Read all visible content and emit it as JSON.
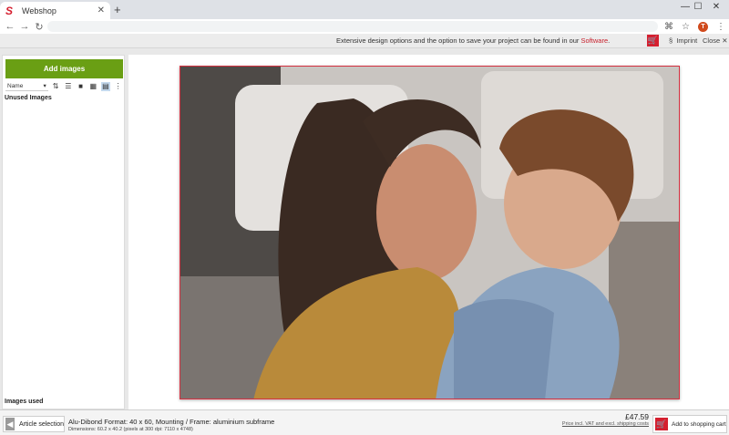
{
  "browser": {
    "tab_title": "Webshop",
    "favicon": "S",
    "new_tab": "+",
    "profile_initial": "T",
    "icons": [
      "back-icon",
      "forward-icon",
      "reload-icon",
      "translate-icon",
      "star-icon",
      "menu-icon"
    ]
  },
  "infobar": {
    "message": "Extensive design options and the option to save your project can be found in our",
    "link": "Software",
    "suffix": ".",
    "imprint": "Imprint",
    "imprint_symbol": "§",
    "close": "Close"
  },
  "sidebar": {
    "add_images": "Add images",
    "sort_value": "Name",
    "unused_images": "Unused Images",
    "images_used": "Images used"
  },
  "footer": {
    "article_selection": "Article selection",
    "format": "Alu-Dibond Format: 40 x 60, Mounting / Frame: aluminium subframe",
    "dimensions": "Dimensions: 60.2 x 40.2 (pixels at 300 dpi: 7110 x 4748)",
    "price": "£47.59",
    "price_note": "Price incl. VAT and excl. shipping costs",
    "add_to_cart": "Add to shopping cart"
  },
  "colors": {
    "accent": "#d51f2f",
    "green": "#6a9f14"
  }
}
